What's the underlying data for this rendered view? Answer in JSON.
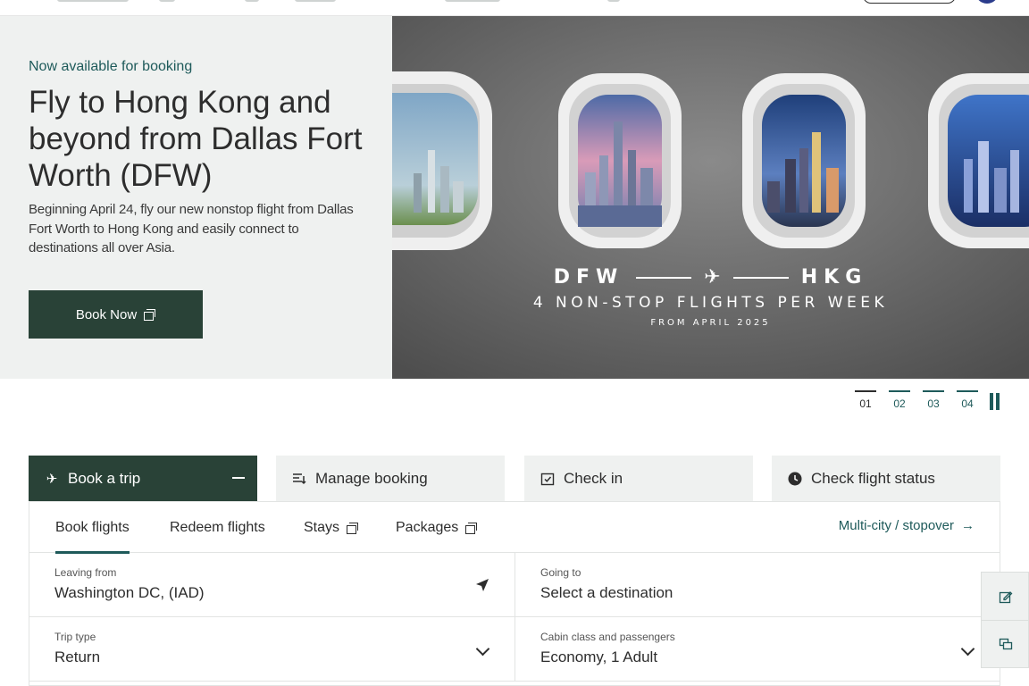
{
  "hero": {
    "eyebrow": "Now available for booking",
    "title": "Fly to Hong Kong and beyond from Dallas Fort Worth (DFW)",
    "description": "Beginning April 24, fly our new nonstop flight from Dallas Fort Worth to Hong Kong and easily connect to destinations all over Asia.",
    "cta_label": "Book Now",
    "banner": {
      "origin": "DFW",
      "destination": "HKG",
      "frequency": "4 NON-STOP FLIGHTS PER WEEK",
      "since": "FROM APRIL 2025"
    }
  },
  "carousel": {
    "slides": [
      "01",
      "02",
      "03",
      "04"
    ],
    "active_index": 0
  },
  "tabs": [
    {
      "label": "Book a trip",
      "icon": "plane-icon",
      "active": true
    },
    {
      "label": "Manage booking",
      "icon": "list-icon",
      "active": false
    },
    {
      "label": "Check in",
      "icon": "check-in-icon",
      "active": false
    },
    {
      "label": "Check flight status",
      "icon": "clock-icon",
      "active": false
    }
  ],
  "subtabs": [
    {
      "label": "Book flights",
      "active": true,
      "external": false
    },
    {
      "label": "Redeem flights",
      "active": false,
      "external": false
    },
    {
      "label": "Stays",
      "active": false,
      "external": true
    },
    {
      "label": "Packages",
      "active": false,
      "external": true
    }
  ],
  "multi_city_label": "Multi-city / stopover",
  "form": {
    "leaving_from": {
      "label": "Leaving from",
      "value": "Washington DC, (IAD)"
    },
    "going_to": {
      "label": "Going to",
      "value": "Select a destination"
    },
    "trip_type": {
      "label": "Trip type",
      "value": "Return"
    },
    "cabin": {
      "label": "Cabin class and passengers",
      "value": "Economy, 1 Adult"
    }
  },
  "colors": {
    "brand_dark": "#294237",
    "brand_teal": "#1e5a5a",
    "panel_bg": "#eff1f0"
  }
}
